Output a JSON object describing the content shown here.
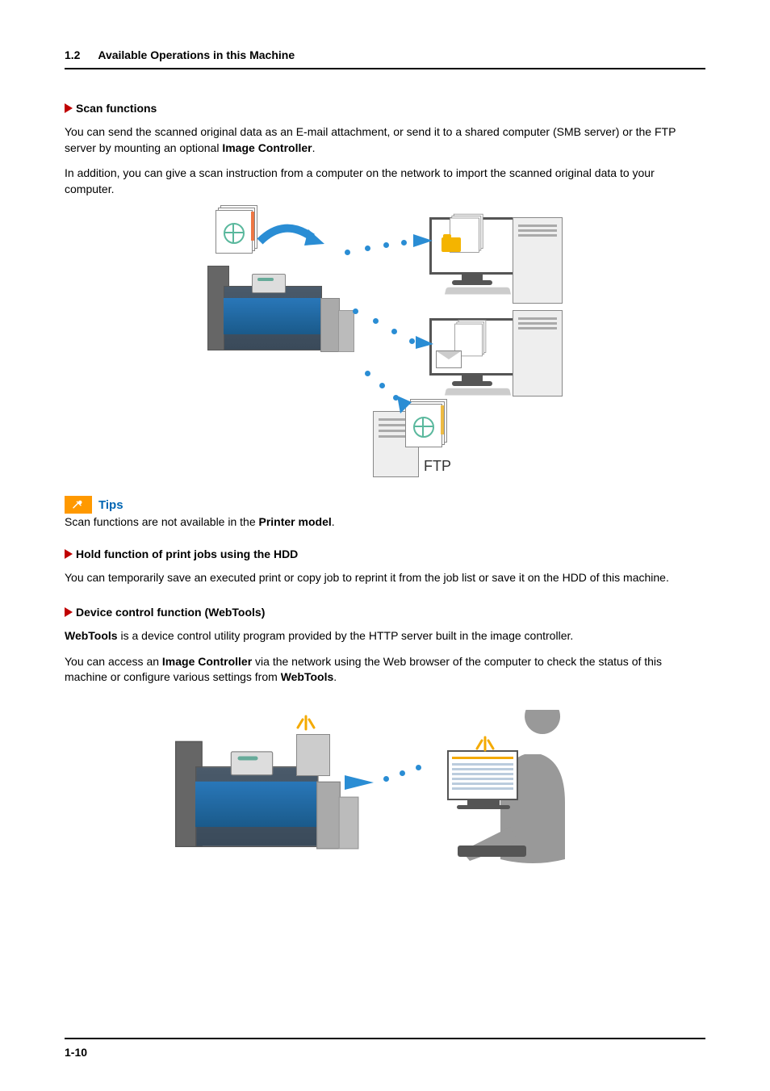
{
  "header": {
    "section_num": "1.2",
    "section_title": "Available Operations in this Machine"
  },
  "sections": {
    "scan": {
      "heading": "Scan functions",
      "p1a": "You can send the scanned original data as an E-mail attachment, or send it to a shared computer (SMB server) or the FTP server by mounting an optional ",
      "p1b": "Image Controller",
      "p1c": ".",
      "p2": "In addition, you can give a scan instruction from a computer on the network to import the scanned original data to your computer.",
      "ftp_label": "FTP"
    },
    "tips": {
      "label": "Tips",
      "text_a": "Scan functions are not available in the ",
      "text_b": "Printer model",
      "text_c": "."
    },
    "hold": {
      "heading": "Hold function of print jobs using the HDD",
      "p1": "You can temporarily save an executed print or copy job to reprint it from the job list or save it on the HDD of this machine."
    },
    "webtools": {
      "heading": "Device control function (WebTools)",
      "p1a": "WebTools",
      "p1b": " is a device control utility program provided by the HTTP server built in the image controller.",
      "p2a": "You can access an ",
      "p2b": "Image Controller",
      "p2c": " via the network using the Web browser of the computer to check the status of this machine or configure various settings from ",
      "p2d": "WebTools",
      "p2e": "."
    }
  },
  "footer": {
    "page_num": "1-10"
  }
}
